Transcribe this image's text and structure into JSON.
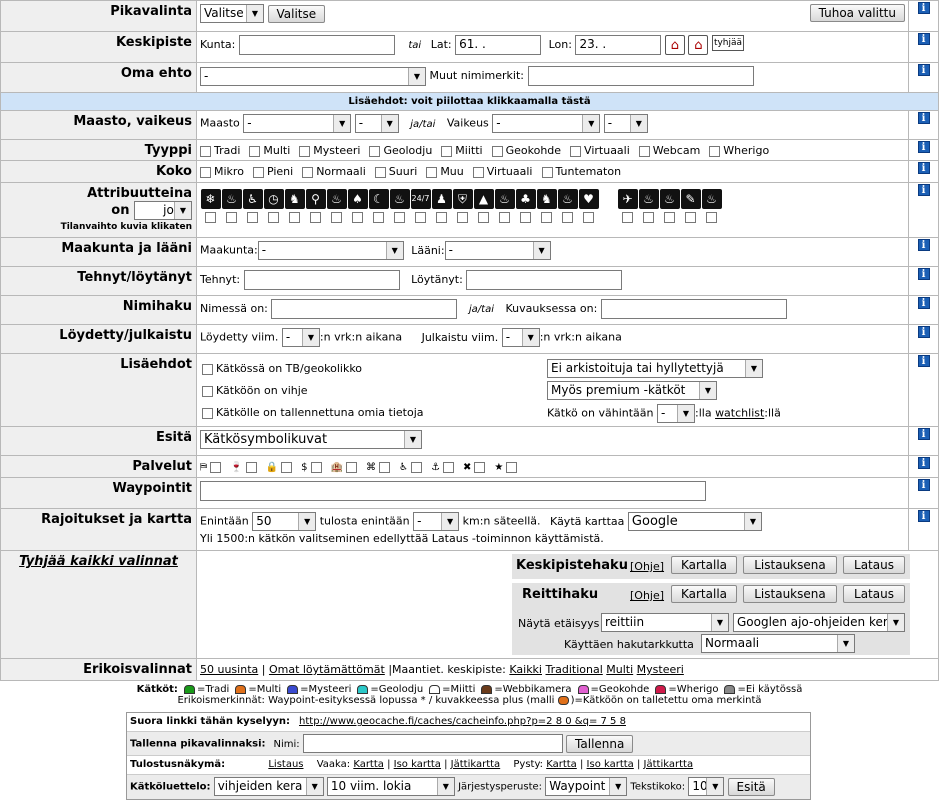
{
  "pikavalinta": {
    "label": "Pikavalinta",
    "select": "Valitse",
    "button": "Valitse",
    "delete": "Tuhoa valittu"
  },
  "keskipiste": {
    "label": "Keskipiste",
    "kunta": "Kunta:",
    "tai": "tai",
    "lat": "Lat:",
    "lat_val": "61.   .",
    "lon": "Lon:",
    "lon_val": "23.   .",
    "empty": "tyhjää"
  },
  "omaehto": {
    "label": "Oma ehto",
    "select": "-",
    "muut": "Muut nimimerkit:"
  },
  "lisaehdot_banner": "Lisäehdot: voit piilottaa klikkaamalla tästä",
  "maasto": {
    "label": "Maasto, vaikeus",
    "maasto": "Maasto",
    "sel1": "-",
    "sel2": "-",
    "jatai": "ja/tai",
    "vaikeus": "Vaikeus",
    "sel3": "-",
    "sel4": "-"
  },
  "tyyppi": {
    "label": "Tyyppi",
    "items": [
      "Tradi",
      "Multi",
      "Mysteeri",
      "Geolodju",
      "Miitti",
      "Geokohde",
      "Virtuaali",
      "Webcam",
      "Wherigo"
    ]
  },
  "koko": {
    "label": "Koko",
    "items": [
      "Mikro",
      "Pieni",
      "Normaali",
      "Suuri",
      "Muu",
      "Virtuaali",
      "Tuntematon"
    ]
  },
  "attr": {
    "label1": "Attribuutteina",
    "on": "on",
    "sel": "joku",
    "note": "Tilanvaihto kuvia klikaten",
    "icons": [
      "❄",
      "♨",
      "♿",
      "◷",
      "♞",
      "⚲",
      "♨",
      "♠",
      "☾",
      "♨",
      "24/7",
      "♟",
      "⛨",
      "▲",
      "♨",
      "♣",
      "♞",
      "♨",
      "♥",
      "✈",
      "♨",
      "♨",
      "✎",
      "♨"
    ]
  },
  "maakunta": {
    "label": "Maakunta ja lääni",
    "maakunta": "Maakunta:",
    "sel1": "-",
    "laani": "Lääni:",
    "sel2": "-"
  },
  "tehnyt": {
    "label": "Tehnyt/löytänyt",
    "tehnyt": "Tehnyt:",
    "loytanyt": "Löytänyt:"
  },
  "nimihaku": {
    "label": "Nimihaku",
    "nimessa": "Nimessä on:",
    "jatai": "ja/tai",
    "kuvauksessa": "Kuvauksessa on:"
  },
  "loydetty": {
    "label": "Löydetty/julkaistu",
    "l1": "Löydetty viim.",
    "sel1": "-",
    "l2": ":n vrk:n aikana",
    "l3": "Julkaistu viim.",
    "sel2": "-",
    "l4": ":n vrk:n aikana"
  },
  "lisa": {
    "label": "Lisäehdot",
    "c1": "Kätkössä on TB/geokolikko",
    "c2": "Kätköön on vihje",
    "c3": "Kätkölle on tallennettuna omia tietoja",
    "s1": "Ei arkistoituja tai hyllytettyjä",
    "s2": "Myös premium -kätköt",
    "v1": "Kätkö on vähintään",
    "sel": "-",
    "v2": ":lla",
    "watch": "watchlist",
    "v3": ":llä"
  },
  "esita": {
    "label": "Esitä",
    "sel": "Kätkösymbolikuvat"
  },
  "palvelut": {
    "label": "Palvelut",
    "icons": [
      "⛿",
      "🍷",
      "🔒",
      "$",
      "🏨",
      "⌘",
      "♿",
      "⚓",
      "✖",
      "★"
    ]
  },
  "waypointit": {
    "label": "Waypointit"
  },
  "rajoitukset": {
    "label": "Rajoitukset ja kartta",
    "enint": "Enintään",
    "sel1": "50",
    "tulosta": "tulosta enintään",
    "sel2": "-",
    "km": "km:n säteellä.",
    "kayta": "Käytä karttaa",
    "sel3": "Google",
    "note": "Yli 1500:n kätkön valitseminen edellyttää Lataus -toiminnon käyttämistä."
  },
  "tyhjaa": "Tyhjää kaikki valinnat",
  "keskipistehaku": {
    "title": "Keskipistehaku",
    "ohje": "[Ohje]",
    "b1": "Kartalla",
    "b2": "Listauksena",
    "b3": "Lataus"
  },
  "reittihaku": {
    "title": "Reittihaku",
    "ohje": "[Ohje]",
    "b1": "Kartalla",
    "b2": "Listauksena",
    "b3": "Lataus",
    "nayta": "Näytä etäisyys",
    "sel1": "reittiin",
    "sel2": "Googlen ajo-ohjeiden kera",
    "kayttaen": "Käyttäen hakutarkkutta",
    "sel3": "Normaali"
  },
  "erikois": {
    "label": "Erikoisvalinnat",
    "l1": "50 uusinta",
    "l2": "Omat löytämättömät",
    "mid": "|Maantiet. keskipiste:",
    "l3": "Kaikki",
    "l4": "Traditional",
    "l5": "Multi",
    "l6": "Mysteeri"
  },
  "legend": {
    "title": "Kätköt:",
    "items": [
      {
        "t": "=Tradi",
        "c": "#1a9a1a"
      },
      {
        "t": "=Multi",
        "c": "#e0701a"
      },
      {
        "t": "=Mysteeri",
        "c": "#3a4ad0"
      },
      {
        "t": "=Geolodju",
        "c": "#2ac8c8"
      },
      {
        "t": "=Miitti",
        "c": "#ffffff"
      },
      {
        "t": "=Webbikamera",
        "c": "#6a3a1a"
      },
      {
        "t": "=Geokohde",
        "c": "#e060d0"
      },
      {
        "t": "=Wherigo",
        "c": "#d01a4a"
      },
      {
        "t": "=Ei käytössä",
        "c": "#888888"
      }
    ],
    "line2": "Erikoismerkinnät: Waypoint-esityksessä lopussa * / kuvakkeessa plus (malli ",
    "line2b": ")=Kätköön on talletettu oma merkintä"
  },
  "bottom": {
    "suora": "Suora linkki tähän kyselyyn:",
    "url": "http://www.geocache.fi/caches/cacheinfo.php?p=2 8 0 &q= 7 5 8",
    "tallenna": "Tallenna pikavalinnaksi:",
    "nimi": "Nimi:",
    "tallennaBtn": "Tallenna",
    "tulostus": "Tulostusnäkymä:",
    "listaus": "Listaus",
    "vaaka": "Vaaka:",
    "kartta": "Kartta",
    "iso": "Iso kartta",
    "jatti": "Jättikartta",
    "pysty": "Pysty:",
    "kartta2": "Kartta",
    "iso2": "Iso kartta",
    "jatti2": "Jättikartta",
    "kluettelo": "Kätköluettelo:",
    "sel1": "vihjeiden kera",
    "sel2": "10 viim. lokia",
    "jarj": "Järjestysperuste:",
    "sel3": "Waypoint",
    "teksti": "Tekstikoko:",
    "sel4": "10",
    "esita": "Esitä"
  }
}
